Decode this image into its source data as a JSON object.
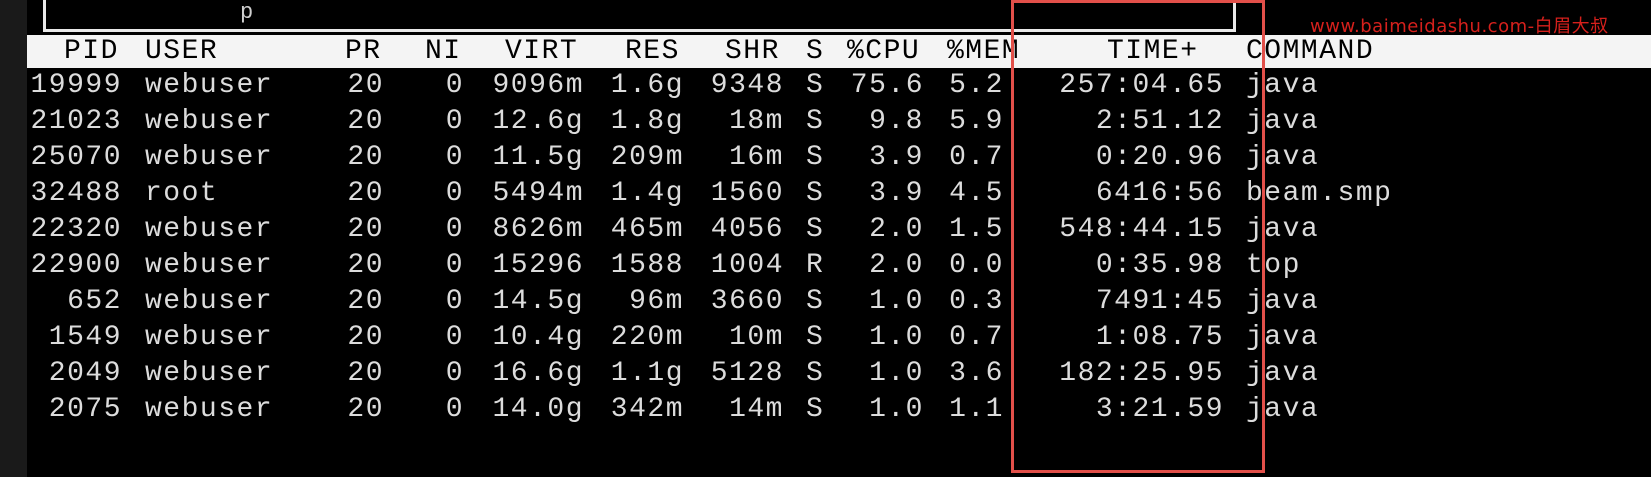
{
  "terminal": {
    "prompt_fragment": "p",
    "watermark": "www.baimeidashu.com-白眉大叔",
    "highlight_color": "#e2504a",
    "headers": {
      "pid": "PID",
      "user": "USER",
      "pr": "PR",
      "ni": "NI",
      "virt": "VIRT",
      "res": "RES",
      "shr": "SHR",
      "s": "S",
      "cpu": "%CPU",
      "mem": "%MEM",
      "time": "TIME+",
      "command": "COMMAND"
    },
    "processes": [
      {
        "pid": "19999",
        "user": "webuser",
        "pr": "20",
        "ni": "0",
        "virt": "9096m",
        "res": "1.6g",
        "shr": "9348",
        "s": "S",
        "cpu": "75.6",
        "mem": "5.2",
        "time": "257:04.65",
        "command": "java"
      },
      {
        "pid": "21023",
        "user": "webuser",
        "pr": "20",
        "ni": "0",
        "virt": "12.6g",
        "res": "1.8g",
        "shr": "18m",
        "s": "S",
        "cpu": "9.8",
        "mem": "5.9",
        "time": "2:51.12",
        "command": "java"
      },
      {
        "pid": "25070",
        "user": "webuser",
        "pr": "20",
        "ni": "0",
        "virt": "11.5g",
        "res": "209m",
        "shr": "16m",
        "s": "S",
        "cpu": "3.9",
        "mem": "0.7",
        "time": "0:20.96",
        "command": "java"
      },
      {
        "pid": "32488",
        "user": "root",
        "pr": "20",
        "ni": "0",
        "virt": "5494m",
        "res": "1.4g",
        "shr": "1560",
        "s": "S",
        "cpu": "3.9",
        "mem": "4.5",
        "time": "6416:56",
        "command": "beam.smp"
      },
      {
        "pid": "22320",
        "user": "webuser",
        "pr": "20",
        "ni": "0",
        "virt": "8626m",
        "res": "465m",
        "shr": "4056",
        "s": "S",
        "cpu": "2.0",
        "mem": "1.5",
        "time": "548:44.15",
        "command": "java"
      },
      {
        "pid": "22900",
        "user": "webuser",
        "pr": "20",
        "ni": "0",
        "virt": "15296",
        "res": "1588",
        "shr": "1004",
        "s": "R",
        "cpu": "2.0",
        "mem": "0.0",
        "time": "0:35.98",
        "command": "top"
      },
      {
        "pid": "652",
        "user": "webuser",
        "pr": "20",
        "ni": "0",
        "virt": "14.5g",
        "res": "96m",
        "shr": "3660",
        "s": "S",
        "cpu": "1.0",
        "mem": "0.3",
        "time": "7491:45",
        "command": "java"
      },
      {
        "pid": "1549",
        "user": "webuser",
        "pr": "20",
        "ni": "0",
        "virt": "10.4g",
        "res": "220m",
        "shr": "10m",
        "s": "S",
        "cpu": "1.0",
        "mem": "0.7",
        "time": "1:08.75",
        "command": "java"
      },
      {
        "pid": "2049",
        "user": "webuser",
        "pr": "20",
        "ni": "0",
        "virt": "16.6g",
        "res": "1.1g",
        "shr": "5128",
        "s": "S",
        "cpu": "1.0",
        "mem": "3.6",
        "time": "182:25.95",
        "command": "java"
      },
      {
        "pid": "2075",
        "user": "webuser",
        "pr": "20",
        "ni": "0",
        "virt": "14.0g",
        "res": "342m",
        "shr": "14m",
        "s": "S",
        "cpu": "1.0",
        "mem": "1.1",
        "time": "3:21.59",
        "command": "java"
      }
    ]
  }
}
